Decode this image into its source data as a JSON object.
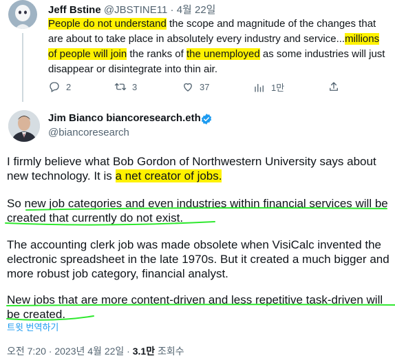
{
  "parent_tweet": {
    "author_name": "Jeff Bstine",
    "handle": "@JBSTINE11",
    "separator": "·",
    "date": "4월 22일",
    "text_segments": [
      {
        "text": "People do not understand",
        "highlight": true
      },
      {
        "text": " the scope and magnitude of the changes that are about to take place in absolutely every industry and service...",
        "highlight": false
      },
      {
        "text": "millions of people will join",
        "highlight": true
      },
      {
        "text": " the ranks of ",
        "highlight": false
      },
      {
        "text": "the unemployed",
        "highlight": true
      },
      {
        "text": " as some industries will just disappear or disintegrate into thin air.",
        "highlight": false
      }
    ],
    "actions": {
      "replies": "2",
      "retweets": "3",
      "likes": "37",
      "views": "1만"
    },
    "icons": [
      "reply-icon",
      "retweet-icon",
      "like-icon",
      "views-icon",
      "share-icon"
    ]
  },
  "main_tweet": {
    "author_name": "Jim Bianco biancoresearch.eth",
    "handle": "@biancoresearch",
    "verified_color": "#1d9bf0",
    "paragraphs": {
      "p1_a": "I firmly believe what Bob Gordon of Northwestern University says about new technology. It is ",
      "p1_hl": "a net creator of jobs.",
      "p2": "So new job categories and even industries within financial services will be created that currently do not exist.",
      "p3": "The accounting clerk job was made obsolete when VisiCalc invented the electronic spreadsheet in the late 1970s. But it created a much bigger and more robust job category, financial analyst.",
      "p4": "New jobs that are more content-driven and less repetitive task-driven will be created."
    },
    "translate_label": "트윗 번역하기",
    "footer": {
      "time": "오전 7:20",
      "sep1": " · ",
      "date": "2023년 4월 22일",
      "sep2": " · ",
      "views_count": "3.1만",
      "views_label": " 조회수"
    }
  },
  "colors": {
    "highlight": "#fff200",
    "underline": "#2ee82e",
    "link": "#1d9bf0",
    "secondary_text": "#536471"
  }
}
